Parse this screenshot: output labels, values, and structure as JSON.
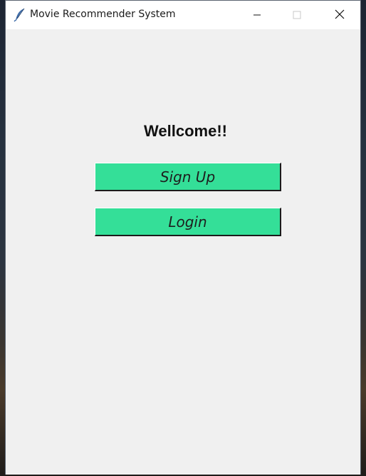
{
  "window": {
    "title": "Movie Recommender System",
    "icon": "feather-icon",
    "controls": {
      "minimize_icon": "minimize-icon",
      "maximize_icon": "maximize-icon",
      "close_icon": "close-icon"
    }
  },
  "main": {
    "welcome_text": "Wellcome!!",
    "signup_label": "Sign Up",
    "login_label": "Login"
  },
  "colors": {
    "button_bg": "#34df98",
    "window_bg": "#f0f0f0",
    "titlebar_bg": "#ffffff"
  }
}
